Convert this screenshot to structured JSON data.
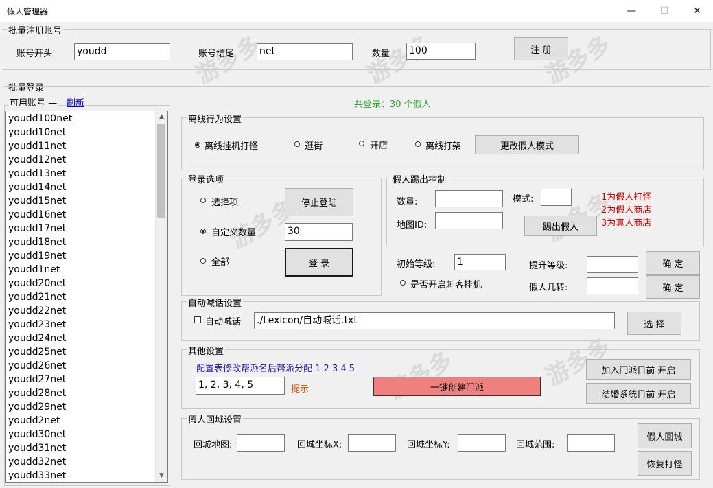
{
  "window": {
    "title": "假人管理器",
    "controls": [
      "—",
      "☐",
      "✕"
    ]
  },
  "watermark": {
    "logo_text": "游多多",
    "sub_text": "Youdd.Net"
  },
  "batch_register": {
    "group_label": "批量注册账号",
    "prefix_label": "账号开头",
    "prefix_value": "youdd",
    "suffix_label": "账号结尾",
    "suffix_value": "net",
    "count_label": "数量",
    "count_value": "100",
    "register_button": "注 册"
  },
  "batch_login": {
    "group_label": "批量登录",
    "accounts_label": "可用账号 —",
    "refresh_link": "刷新",
    "total_logged_in": "共登录：30 个假人",
    "accounts": [
      "youdd100net",
      "youdd10net",
      "youdd11net",
      "youdd12net",
      "youdd13net",
      "youdd14net",
      "youdd15net",
      "youdd16net",
      "youdd17net",
      "youdd18net",
      "youdd19net",
      "youdd1net",
      "youdd20net",
      "youdd21net",
      "youdd22net",
      "youdd23net",
      "youdd24net",
      "youdd25net",
      "youdd26net",
      "youdd27net",
      "youdd28net",
      "youdd29net",
      "youdd2net",
      "youdd30net",
      "youdd31net",
      "youdd32net",
      "youdd33net"
    ]
  },
  "offline_behavior": {
    "group_label": "离线行为设置",
    "options": [
      "离线挂机打怪",
      "逛街",
      "开店",
      "离线打架"
    ],
    "selected": 0,
    "change_mode_button": "更改假人模式"
  },
  "login_options": {
    "group_label": "登录选项",
    "opt_select": "选择项",
    "opt_custom": "自定义数量",
    "opt_all": "全部",
    "custom_value": "30",
    "stop_button": "停止登陆",
    "login_button": "登 录"
  },
  "kick": {
    "group_label": "假人踢出控制",
    "count_label": "数量:",
    "map_label": "地图ID:",
    "mode_label": "模式:",
    "kick_button": "踢出假人",
    "hints": [
      "1为假人打怪",
      "2为假人商店",
      "3为真人商店"
    ]
  },
  "level": {
    "initial_label": "初始等级:",
    "initial_value": "1",
    "assassin_label": "是否开启刺客挂机",
    "raise_label": "提升等级:",
    "rebirth_label": "假人几转:",
    "confirm1": "确 定",
    "confirm2": "确 定"
  },
  "auto_shout": {
    "group_label": "自动喊话设置",
    "checkbox_label": "自动喊话",
    "path_value": "./Lexicon/自动喊话.txt",
    "choose_button": "选 择"
  },
  "other": {
    "group_label": "其他设置",
    "config_hint": "配置表修改帮派名后帮派分配 1 2 3 4 5",
    "config_value": "1, 2, 3, 4, 5",
    "tip_label": "提示",
    "create_guild_button": "一键创建门派",
    "join_guild_button": "加入门派目前 开启",
    "marriage_button": "结婚系统目前 开启"
  },
  "return_city": {
    "group_label": "假人回城设置",
    "map_label": "回城地图:",
    "x_label": "回城坐标X:",
    "y_label": "回城坐标Y:",
    "range_label": "回城范围:",
    "return_button": "假人回城",
    "resume_button": "恢复打怪"
  },
  "colors": {
    "accent_green": "#2ca02c",
    "hint_red": "#d40000",
    "link_blue": "#0000ee",
    "create_btn": "#f08080",
    "blue_text": "#1a1aa6"
  }
}
